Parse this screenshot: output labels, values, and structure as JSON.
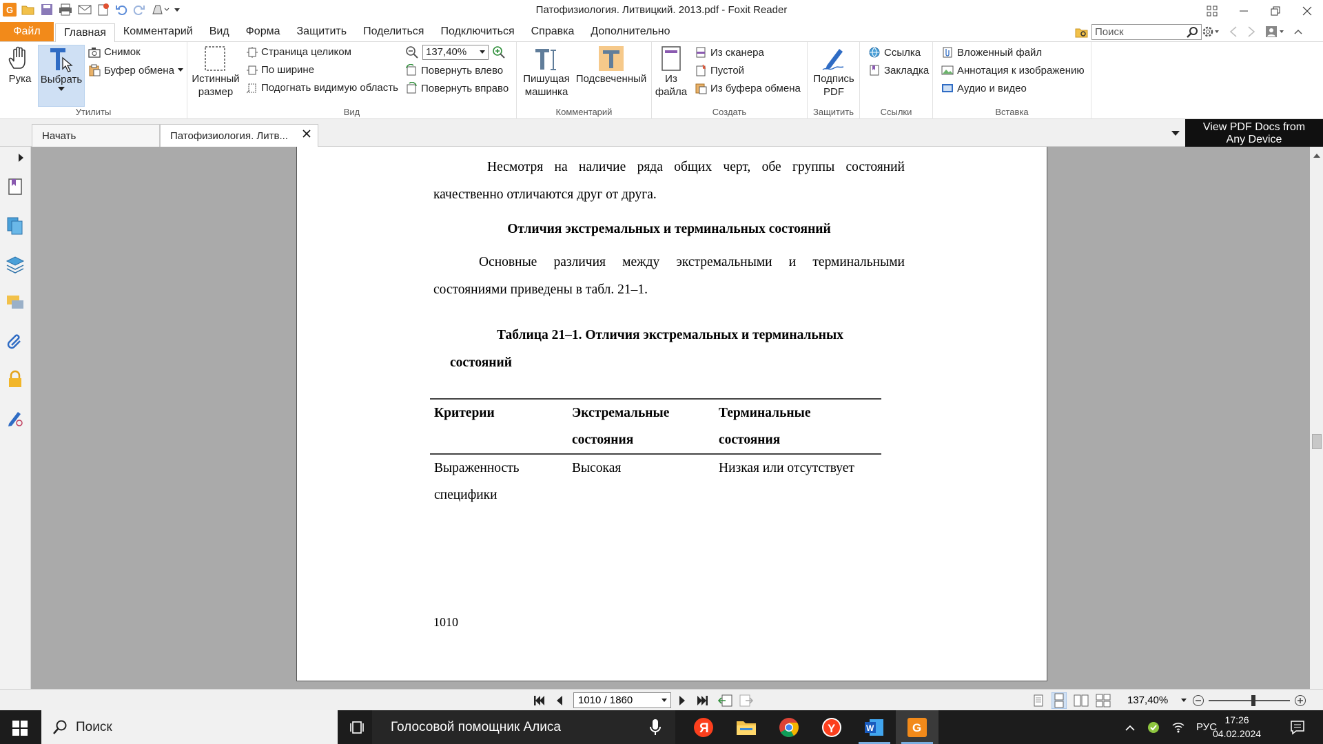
{
  "titlebar": {
    "title": "Патофизиология. Литвицкий. 2013.pdf - Foxit Reader"
  },
  "menubar": {
    "file": "Файл",
    "items": [
      "Главная",
      "Комментарий",
      "Вид",
      "Форма",
      "Защитить",
      "Поделиться",
      "Подключиться",
      "Справка",
      "Дополнительно"
    ],
    "active_index": 0,
    "search_placeholder": "Поиск"
  },
  "ribbon": {
    "utilities": {
      "label": "Утилиты",
      "hand": "Рука",
      "select": "Выбрать",
      "snapshot": "Снимок",
      "clipboard": "Буфер обмена"
    },
    "view": {
      "label": "Вид",
      "actual_size_1": "Истинный",
      "actual_size_2": "размер",
      "fit_page": "Страница целиком",
      "fit_width": "По ширине",
      "fit_visible": "Подогнать видимую область",
      "zoom_value": "137,40%",
      "rotate_left": "Повернуть влево",
      "rotate_right": "Повернуть вправо"
    },
    "comment": {
      "label": "Комментарий",
      "typewriter_1": "Пишущая",
      "typewriter_2": "машинка",
      "highlight": "Подсвеченный"
    },
    "create": {
      "label": "Создать",
      "from_file_1": "Из",
      "from_file_2": "файла",
      "from_scanner": "Из сканера",
      "blank": "Пустой",
      "from_clipboard": "Из буфера обмена"
    },
    "protect": {
      "label": "Защитить",
      "sign_1": "Подпись",
      "sign_2": "PDF"
    },
    "links": {
      "label": "Ссылки",
      "link": "Ссылка",
      "bookmark": "Закладка"
    },
    "insert": {
      "label": "Вставка",
      "attachment": "Вложенный файл",
      "image_annot": "Аннотация к изображению",
      "audio_video": "Аудио и видео"
    }
  },
  "tabs": {
    "start": "Начать",
    "doc": "Патофизиология. Литв...",
    "ad_line1": "View PDF Docs from",
    "ad_line2": "Any Device"
  },
  "document": {
    "para1": "Несмотря на наличие ряда общих черт, обе группы состояний качественно отличаются друг от друга.",
    "heading": "Отличия экстремальных и терминальных состояний",
    "para2": "Основные различия между экстремальными и терминальными состояниями приведены в табл. 21–1.",
    "table_caption_1": "Таблица 21–1. Отличия экстремальных и терминальных",
    "table_caption_2": "состояний",
    "table": {
      "headers": [
        [
          "Критерии",
          ""
        ],
        [
          "Экстремальные",
          "состояния"
        ],
        [
          "Терминальные",
          "состояния"
        ]
      ],
      "rows": [
        [
          [
            "Выраженность",
            "специфики"
          ],
          [
            "Высокая",
            ""
          ],
          [
            "Низкая или отсутствует",
            ""
          ]
        ]
      ]
    },
    "page_number": "1010"
  },
  "statusbar": {
    "page": "1010 / 1860",
    "zoom": "137,40%"
  },
  "taskbar": {
    "search": "Поиск",
    "alice": "Голосовой помощник Алиса",
    "lang": "РУС",
    "time": "17:26",
    "date": "04.02.2024"
  }
}
